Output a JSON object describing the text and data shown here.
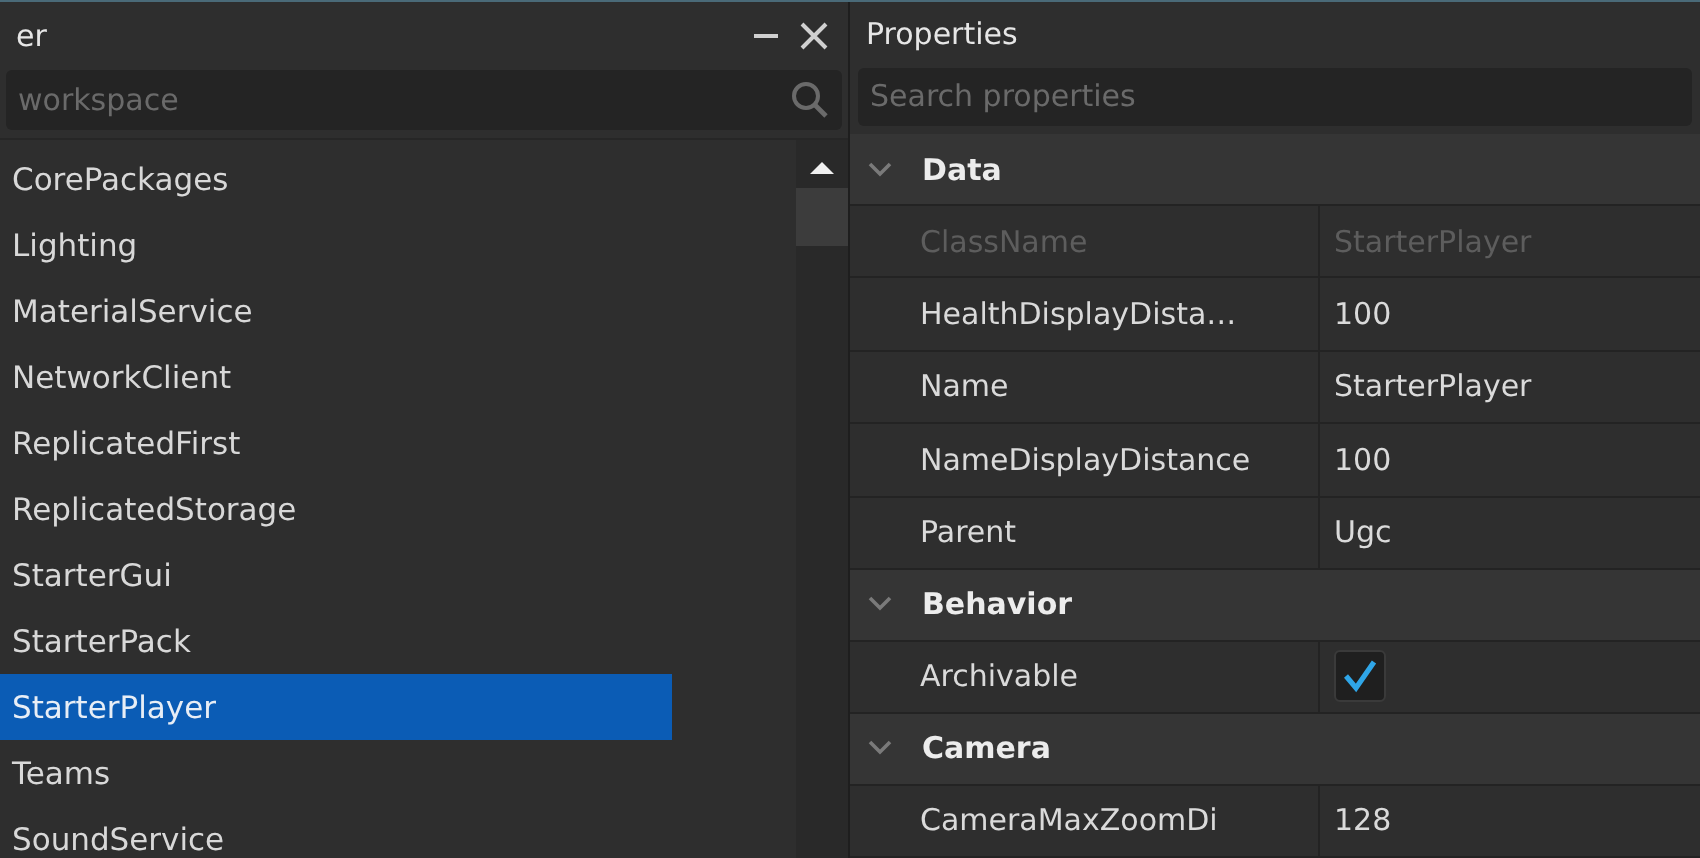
{
  "explorer": {
    "title": "er",
    "search": {
      "placeholder": "workspace"
    },
    "items": [
      {
        "label": "CorePackages",
        "selected": false
      },
      {
        "label": "Lighting",
        "selected": false
      },
      {
        "label": "MaterialService",
        "selected": false
      },
      {
        "label": "NetworkClient",
        "selected": false
      },
      {
        "label": "ReplicatedFirst",
        "selected": false
      },
      {
        "label": "ReplicatedStorage",
        "selected": false
      },
      {
        "label": "StarterGui",
        "selected": false
      },
      {
        "label": "StarterPack",
        "selected": false
      },
      {
        "label": "StarterPlayer",
        "selected": true
      },
      {
        "label": "Teams",
        "selected": false
      },
      {
        "label": "SoundService",
        "selected": false
      }
    ]
  },
  "properties": {
    "title": "Properties",
    "search": {
      "placeholder": "Search properties"
    },
    "groups": [
      {
        "name": "Data",
        "expanded": true,
        "rows": [
          {
            "kind": "text",
            "name": "ClassName",
            "value": "StarterPlayer",
            "disabled": true
          },
          {
            "kind": "text",
            "name": "HealthDisplayDista…",
            "value": "100",
            "disabled": false
          },
          {
            "kind": "text",
            "name": "Name",
            "value": "StarterPlayer",
            "disabled": false
          },
          {
            "kind": "text",
            "name": "NameDisplayDistance",
            "value": "100",
            "disabled": false
          },
          {
            "kind": "text",
            "name": "Parent",
            "value": "Ugc",
            "disabled": false
          }
        ]
      },
      {
        "name": "Behavior",
        "expanded": true,
        "rows": [
          {
            "kind": "checkbox",
            "name": "Archivable",
            "checked": true,
            "disabled": false
          }
        ]
      },
      {
        "name": "Camera",
        "expanded": true,
        "rows": [
          {
            "kind": "text",
            "name": "CameraMaxZoomDi",
            "value": "128",
            "disabled": false
          }
        ]
      }
    ]
  }
}
